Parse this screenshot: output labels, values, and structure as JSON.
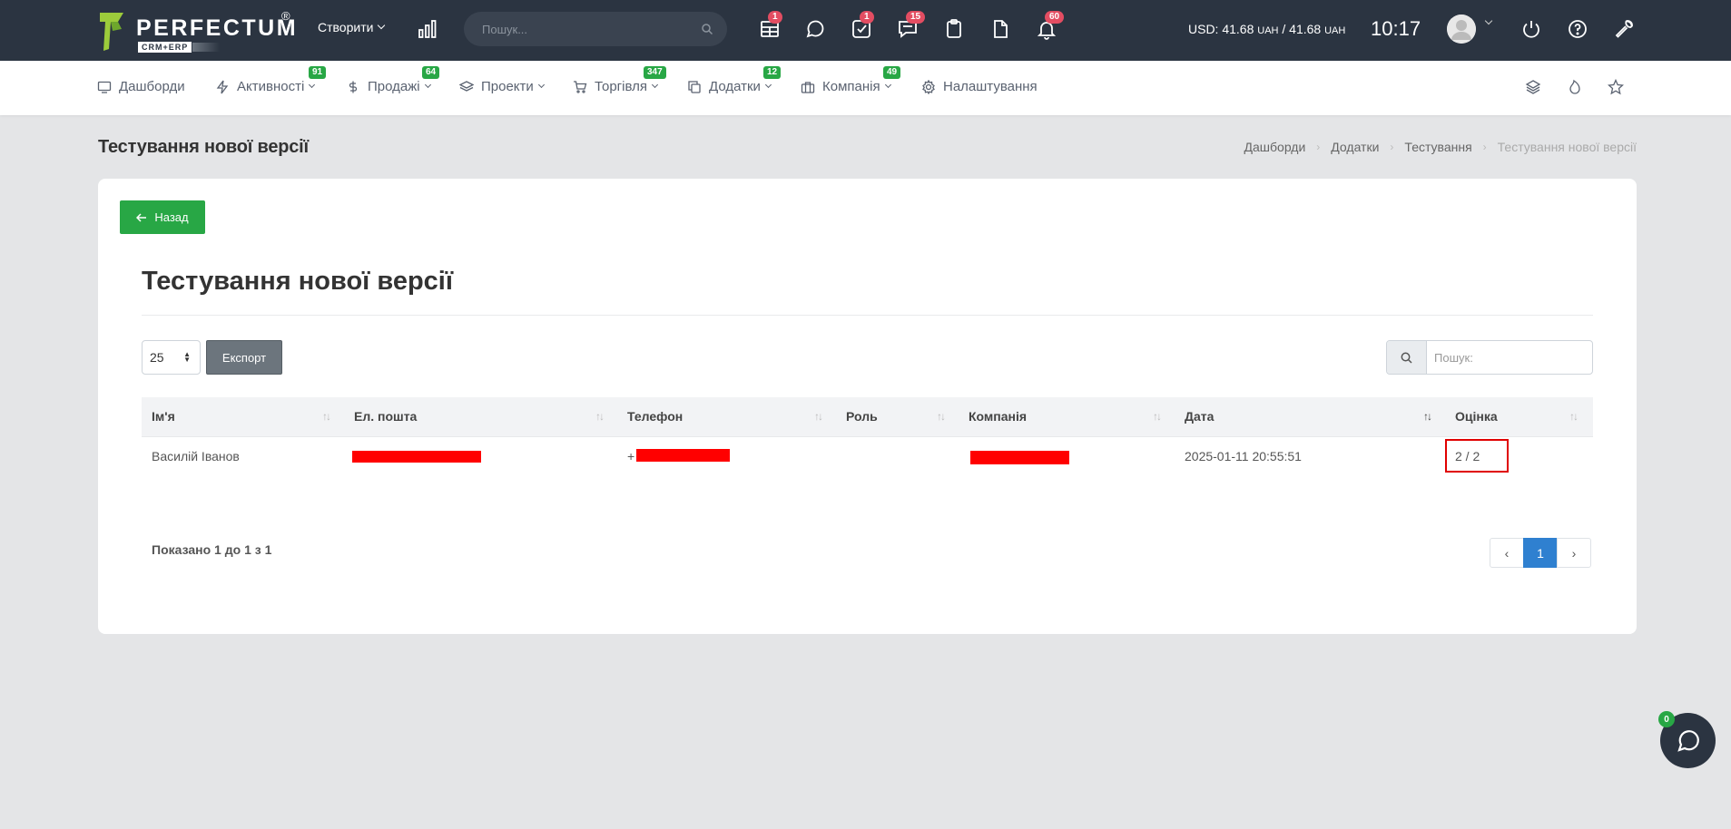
{
  "topbar": {
    "brand": "PERFECTUM",
    "brand_reg": "®",
    "brand_sub": "CRM+ERP",
    "create_label": "Створити",
    "search_placeholder": "Пошук...",
    "icons": [
      {
        "name": "table-icon",
        "badge": "1"
      },
      {
        "name": "chat-bubble-icon",
        "badge": ""
      },
      {
        "name": "task-check-icon",
        "badge": "1"
      },
      {
        "name": "messages-icon",
        "badge": "15"
      },
      {
        "name": "clipboard-icon",
        "badge": ""
      },
      {
        "name": "document-icon",
        "badge": ""
      },
      {
        "name": "bell-icon",
        "badge": "60"
      }
    ],
    "currency_prefix": "USD: 41.68",
    "currency_unit1": "UAH",
    "currency_mid": " / 41.68",
    "currency_unit2": "UAH",
    "clock": "10:17",
    "accent_color": "#2b3441"
  },
  "menu": {
    "items": [
      {
        "label": "Дашборди",
        "icon": "monitor-icon",
        "badge": ""
      },
      {
        "label": "Активності",
        "icon": "bolt-icon",
        "badge": "91"
      },
      {
        "label": "Продажі",
        "icon": "dollar-icon",
        "badge": "64"
      },
      {
        "label": "Проекти",
        "icon": "layers-icon",
        "badge": ""
      },
      {
        "label": "Торгівля",
        "icon": "cart-icon",
        "badge": "347"
      },
      {
        "label": "Додатки",
        "icon": "copy-icon",
        "badge": "12"
      },
      {
        "label": "Компанія",
        "icon": "briefcase-icon",
        "badge": "49"
      },
      {
        "label": "Налаштування",
        "icon": "gear-icon",
        "badge": ""
      }
    ],
    "badge_color": "#28a745"
  },
  "page": {
    "title": "Тестування нової версії",
    "breadcrumb": [
      "Дашборди",
      "Додатки",
      "Тестування",
      "Тестування нової версії"
    ],
    "back_label": "Назад",
    "heading": "Тестування нової версії",
    "page_length": "25",
    "export_label": "Експорт",
    "search_placeholder": "Пошук:"
  },
  "table": {
    "columns": [
      "Ім'я",
      "Ел. пошта",
      "Телефон",
      "Роль",
      "Компанія",
      "Дата",
      "Оцінка"
    ],
    "rows": [
      {
        "name": "Василій Іванов",
        "email": "",
        "phone": "+",
        "role": "",
        "company": "",
        "date": "2025-01-11 20:55:51",
        "score": "2 / 2"
      }
    ],
    "info_prefix": "Показано ",
    "info_from": "1",
    "info_mid1": " до ",
    "info_to": "1",
    "info_mid2": " з ",
    "info_total": "1"
  },
  "pagination": {
    "prev": "‹",
    "current": "1",
    "next": "›",
    "active_color": "#2f80d0"
  },
  "chat": {
    "badge": "0"
  }
}
